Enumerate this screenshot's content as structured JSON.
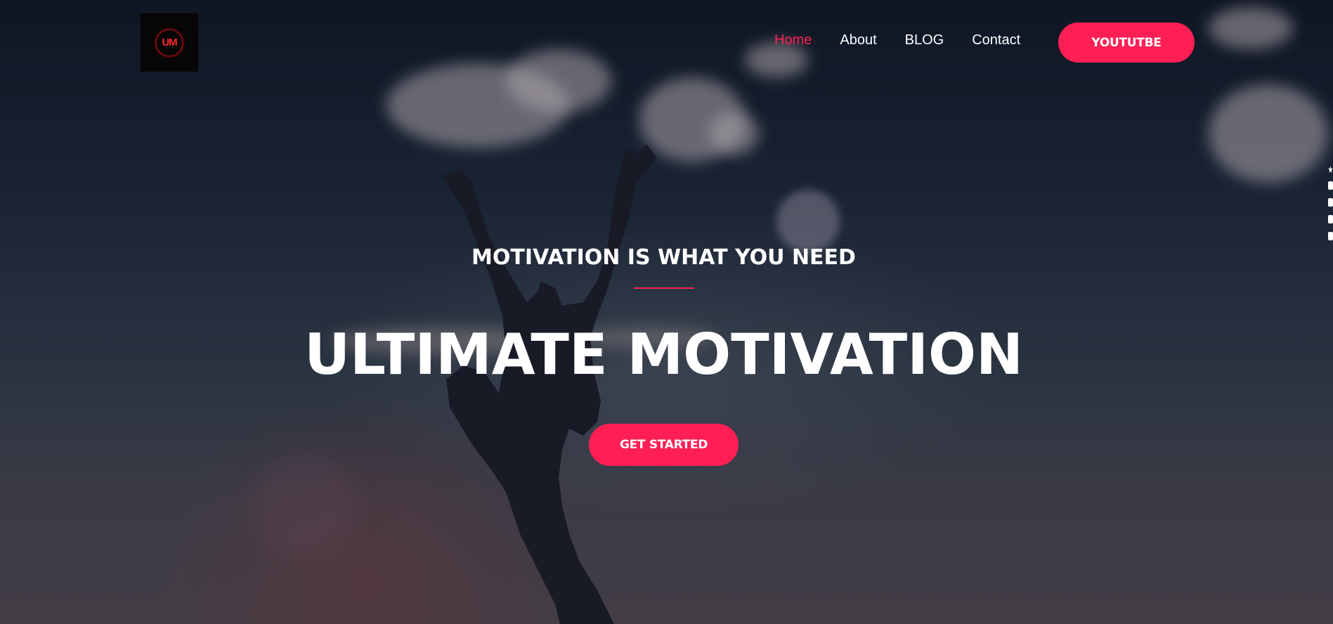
{
  "logo": {
    "text": "UM",
    "icon": "um-logo-icon"
  },
  "nav": {
    "items": [
      {
        "label": "Home",
        "active": true
      },
      {
        "label": "About",
        "active": false
      },
      {
        "label": "BLOG",
        "active": false
      },
      {
        "label": "Contact",
        "active": false
      }
    ],
    "cta_label": "YOUTUTBE"
  },
  "hero": {
    "subtitle": "MOTIVATION IS WHAT YOU NEED",
    "title": "ULTIMATE MOTIVATION",
    "button_label": "GET STARTED"
  },
  "side_icons": [
    "star-icon",
    "square-icon",
    "square-icon",
    "copy-icon",
    "gear-icon"
  ],
  "colors": {
    "accent": "#ff1f55",
    "text": "#ffffff",
    "logo_bg": "#060606"
  }
}
